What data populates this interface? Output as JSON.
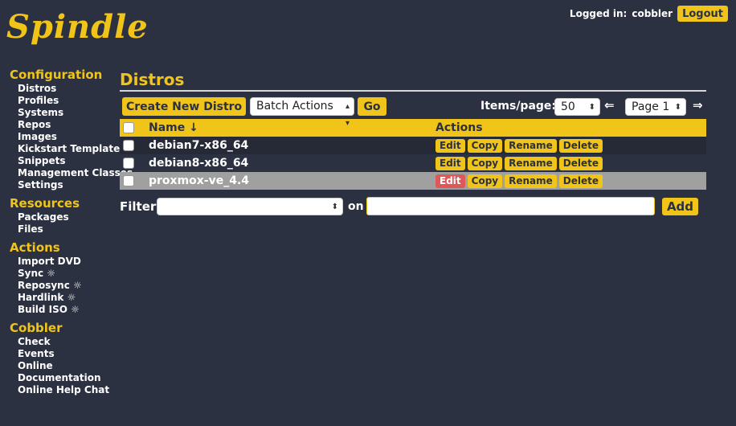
{
  "app": {
    "logo": "Spindle"
  },
  "header": {
    "logged_in_label": "Logged in:",
    "user": "cobbler",
    "logout_label": "Logout"
  },
  "sidebar": {
    "configuration": {
      "title": "Configuration",
      "items": [
        "Distros",
        "Profiles",
        "Systems",
        "Repos",
        "Images",
        "Kickstart Templates",
        "Snippets",
        "Management Classes",
        "Settings"
      ]
    },
    "resources": {
      "title": "Resources",
      "items": [
        "Packages",
        "Files"
      ]
    },
    "actions": {
      "title": "Actions",
      "items": [
        "Import DVD",
        "Sync ☼",
        "Reposync ☼",
        "Hardlink ☼",
        "Build ISO ☼"
      ]
    },
    "cobbler": {
      "title": "Cobbler",
      "items": [
        "Check",
        "Events",
        "Online",
        "Documentation",
        "Online Help Chat"
      ]
    }
  },
  "main": {
    "title": "Distros",
    "create_label": "Create New Distro",
    "batch_actions": "Batch Actions",
    "go_label": "Go",
    "items_per_page_label": "Items/page:",
    "items_per_page": "50",
    "prev_arrow": "⇐",
    "page": "Page 1",
    "next_arrow": "⇒",
    "table": {
      "col_name": "Name ↓",
      "col_actions": "Actions",
      "action_labels": {
        "edit": "Edit",
        "copy": "Copy",
        "rename": "Rename",
        "delete": "Delete"
      },
      "rows": [
        {
          "name": "debian7-x86_64"
        },
        {
          "name": "debian8-x86_64"
        },
        {
          "name": "proxmox-ve_4.4"
        }
      ]
    },
    "filter": {
      "label": "Filter",
      "on_label": "on",
      "select_value": "",
      "input_value": "",
      "add_label": "Add"
    }
  },
  "colors": {
    "accent": "#f0c419",
    "background": "#2c3142",
    "selected_row": "#a0a0a0",
    "edit_highlight": "#e05757"
  }
}
